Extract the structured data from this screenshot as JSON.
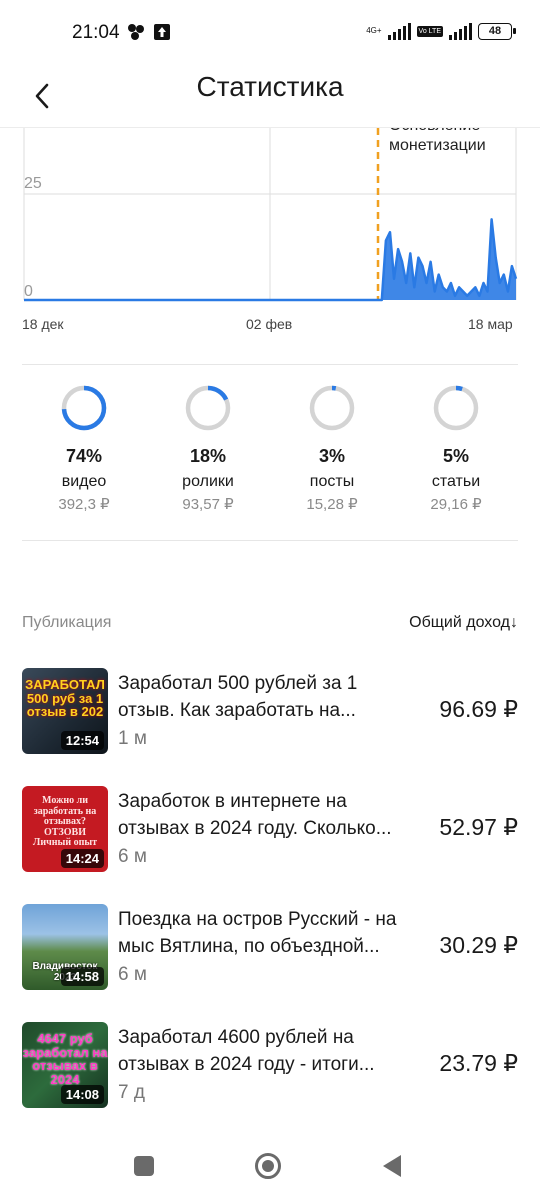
{
  "status_bar": {
    "time": "21:04",
    "network_label": "4G+",
    "volte_label": "Vo LTE",
    "battery": "48"
  },
  "header": {
    "title": "Статистика"
  },
  "chart_data": {
    "type": "line",
    "yticks": [
      "25",
      "0"
    ],
    "xticks": [
      "18 дек",
      "02 фев",
      "18 мар"
    ],
    "annotation": "Основление монетизации",
    "annotation_lines": [
      "Основление",
      "монетизации"
    ],
    "series_color": "#2a7ae4",
    "marker_color": "#f0a020",
    "values": [
      0,
      0,
      0,
      0,
      0,
      0,
      0,
      0,
      0,
      0,
      0,
      0,
      0,
      0,
      0,
      0,
      0,
      0,
      0,
      0,
      0,
      0,
      0,
      0,
      0,
      0,
      0,
      0,
      0,
      0,
      0,
      0,
      0,
      0,
      0,
      0,
      0,
      0,
      0,
      0,
      0,
      0,
      0,
      0,
      0,
      0,
      0,
      0,
      0,
      0,
      0,
      0,
      0,
      0,
      0,
      0,
      0,
      0,
      0,
      0,
      0,
      0,
      0,
      0,
      0,
      0,
      0,
      0,
      0,
      0,
      0,
      0,
      0,
      0,
      0,
      0,
      0,
      0,
      0,
      0,
      0,
      0,
      0,
      0,
      0,
      0,
      0,
      0,
      0,
      14,
      16,
      5,
      12,
      9,
      4,
      11,
      3,
      10,
      8,
      4,
      9,
      2,
      6,
      3,
      2,
      4,
      1,
      3,
      2,
      1,
      2,
      3,
      1,
      4,
      2,
      19,
      10,
      4,
      6,
      2,
      8,
      5
    ]
  },
  "breakdown": [
    {
      "percent": "74%",
      "fraction": 0.74,
      "label": "видео",
      "amount": "392,3 ₽"
    },
    {
      "percent": "18%",
      "fraction": 0.18,
      "label": "ролики",
      "amount": "93,57 ₽"
    },
    {
      "percent": "3%",
      "fraction": 0.03,
      "label": "посты",
      "amount": "15,28 ₽"
    },
    {
      "percent": "5%",
      "fraction": 0.05,
      "label": "статьи",
      "amount": "29,16 ₽"
    }
  ],
  "list_header": {
    "publication": "Публикация",
    "sort_label": "Общий доход↓"
  },
  "publications": [
    {
      "title": "Заработал 500 рублей за 1 отзыв. Как заработать на...",
      "age": "1 м",
      "income": "96.69 ₽",
      "duration": "12:54",
      "thumb_text": "ЗАРАБОТАЛ 500 руб за 1 отзыв в 202"
    },
    {
      "title": "Заработок в интернете на отзывах в 2024 году. Сколько...",
      "age": "6 м",
      "income": "52.97 ₽",
      "duration": "14:24",
      "thumb_text": "Можно ли заработать на отзывах? ОТЗОВИ Личный опыт"
    },
    {
      "title": "Поездка на остров Русский - на мыс Вятлина, по объездной...",
      "age": "6 м",
      "income": "30.29 ₽",
      "duration": "14:58",
      "thumb_text": "Владивосток 2023"
    },
    {
      "title": "Заработал 4600 рублей на отзывах в 2024 году - итоги...",
      "age": "7 д",
      "income": "23.79 ₽",
      "duration": "14:08",
      "thumb_text": "4647 руб заработал на отзывах в 2024"
    }
  ],
  "colors": {
    "accent": "#2a7ae4",
    "ring_track": "#d4d4d4"
  }
}
